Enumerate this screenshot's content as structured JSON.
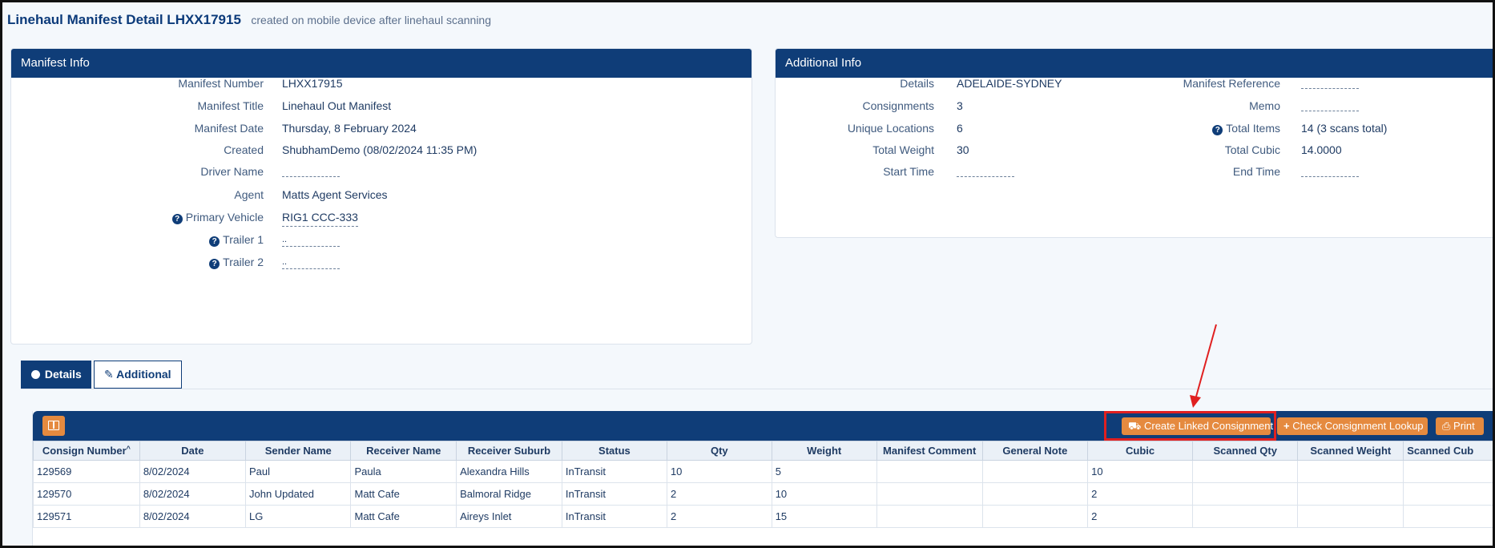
{
  "header": {
    "title": "Linehaul Manifest Detail LHXX17915",
    "subtitle": "created on mobile device after linehaul scanning"
  },
  "manifest_info": {
    "title": "Manifest Info",
    "fields": {
      "manifest_number": {
        "label": "Manifest Number",
        "value": "LHXX17915"
      },
      "manifest_title": {
        "label": "Manifest Title",
        "value": "Linehaul Out Manifest"
      },
      "manifest_date": {
        "label": "Manifest Date",
        "value": "Thursday, 8 February 2024"
      },
      "created": {
        "label": "Created",
        "value": "ShubhamDemo (08/02/2024 11:35 PM)"
      },
      "driver_name": {
        "label": "Driver Name",
        "value": ""
      },
      "agent": {
        "label": "Agent",
        "value": "Matts Agent Services"
      },
      "primary_vehicle": {
        "label": "Primary Vehicle",
        "value": "RIG1 CCC-333"
      },
      "trailer1": {
        "label": "Trailer 1",
        "value": ".."
      },
      "trailer2": {
        "label": "Trailer 2",
        "value": ".."
      }
    }
  },
  "additional_info": {
    "title": "Additional Info",
    "left": {
      "details": {
        "label": "Details",
        "value": "ADELAIDE-SYDNEY"
      },
      "consignments": {
        "label": "Consignments",
        "value": "3"
      },
      "unique_locations": {
        "label": "Unique Locations",
        "value": "6"
      },
      "total_weight": {
        "label": "Total Weight",
        "value": "30"
      },
      "start_time": {
        "label": "Start Time",
        "value": ""
      }
    },
    "right": {
      "manifest_reference": {
        "label": "Manifest Reference",
        "value": ""
      },
      "memo": {
        "label": "Memo",
        "value": ""
      },
      "total_items": {
        "label": "Total Items",
        "value": "14 (3 scans total)"
      },
      "total_cubic": {
        "label": "Total Cubic",
        "value": "14.0000"
      },
      "end_time": {
        "label": "End Time",
        "value": ""
      }
    }
  },
  "tabs": {
    "details": "Details",
    "additional": "Additional"
  },
  "toolbar": {
    "create_linked": "Create Linked Consignment",
    "check_lookup": "Check Consignment Lookup",
    "print": "Print"
  },
  "table": {
    "columns": [
      "Consign Number",
      "Date",
      "Sender Name",
      "Receiver Name",
      "Receiver Suburb",
      "Status",
      "Qty",
      "Weight",
      "Manifest Comment",
      "General Note",
      "Cubic",
      "Scanned Qty",
      "Scanned Weight",
      "Scanned Cub"
    ],
    "rows": [
      [
        "129569",
        "8/02/2024",
        "Paul",
        "Paula",
        "Alexandra Hills",
        "InTransit",
        "10",
        "5",
        "",
        "",
        "10",
        "",
        "",
        ""
      ],
      [
        "129570",
        "8/02/2024",
        "John Updated",
        "Matt Cafe",
        "Balmoral Ridge",
        "InTransit",
        "2",
        "10",
        "",
        "",
        "2",
        "",
        "",
        ""
      ],
      [
        "129571",
        "8/02/2024",
        "LG",
        "Matt Cafe",
        "Aireys Inlet",
        "InTransit",
        "2",
        "15",
        "",
        "",
        "2",
        "",
        "",
        ""
      ]
    ]
  },
  "colors": {
    "primary": "#0f3d78",
    "accent": "#e58a3f",
    "highlight": "#e02020"
  }
}
